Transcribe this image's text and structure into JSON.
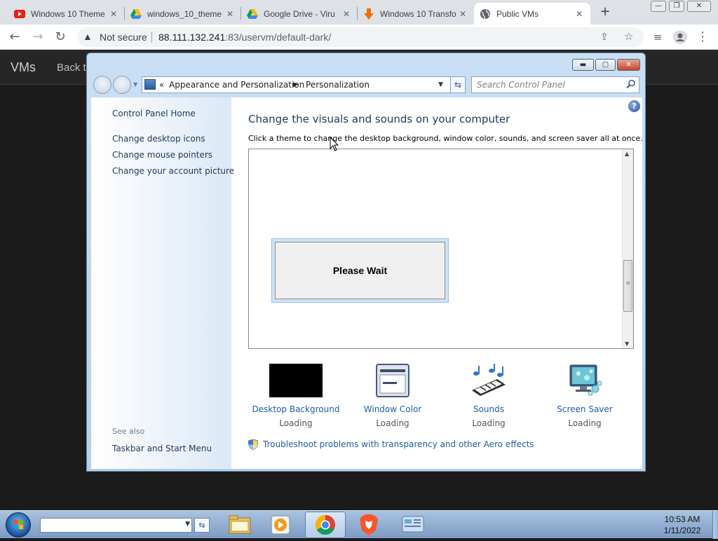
{
  "browser": {
    "tabs": [
      {
        "title": "Windows 10 Theme",
        "icon": "youtube-icon"
      },
      {
        "title": "windows_10_theme",
        "icon": "google-drive-icon"
      },
      {
        "title": "Google Drive - Viru",
        "icon": "google-drive-icon"
      },
      {
        "title": "Windows 10 Transfo",
        "icon": "download-arrow-icon"
      },
      {
        "title": "Public VMs",
        "icon": "globe-icon",
        "active": true
      }
    ],
    "new_tab_label": "+",
    "omnibox": {
      "security_text": "Not secure",
      "url_host": "88.111.132.241",
      "url_rest": ":83/uservm/default-dark/"
    }
  },
  "site": {
    "brand": "VMs",
    "back_link": "Back to"
  },
  "control_panel": {
    "address": {
      "chevron": "«",
      "crumb1": "Appearance and Personalization",
      "crumb2": "Personalization"
    },
    "search_placeholder": "Search Control Panel",
    "left_links": [
      "Control Panel Home",
      "Change desktop icons",
      "Change mouse pointers",
      "Change your account picture"
    ],
    "see_also_label": "See also",
    "see_also_links": [
      "Taskbar and Start Menu"
    ],
    "title": "Change the visuals and sounds on your computer",
    "subtitle": "Click a theme to change the desktop background, window color, sounds, and screen saver all at once.",
    "wait_text": "Please Wait",
    "tiles": [
      {
        "label": "Desktop Background",
        "status": "Loading",
        "icon": "desktop-background-icon"
      },
      {
        "label": "Window Color",
        "status": "Loading",
        "icon": "window-color-icon"
      },
      {
        "label": "Sounds",
        "status": "Loading",
        "icon": "sounds-icon"
      },
      {
        "label": "Screen Saver",
        "status": "Loading",
        "icon": "screen-saver-icon"
      }
    ],
    "troubleshoot_link": "Troubleshoot problems with transparency and other Aero effects"
  },
  "taskbar": {
    "time": "10:53 AM",
    "date": "1/11/2022",
    "apps": [
      "file-explorer-icon",
      "media-player-icon",
      "chrome-icon",
      "brave-icon",
      "control-panel-icon"
    ]
  },
  "colors": {
    "link": "#1e5d9e",
    "heading": "#1e3a5a",
    "page_bg": "#1b1b1b"
  }
}
